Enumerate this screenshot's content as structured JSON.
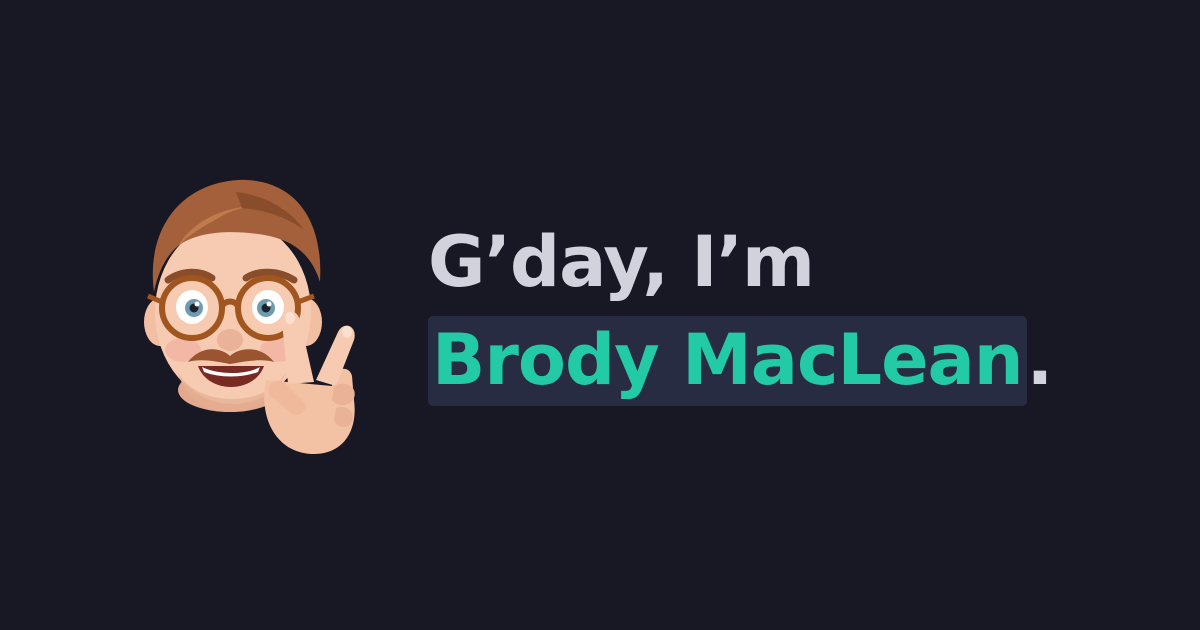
{
  "greeting": "G’day, I’m",
  "name": "Brody MacLean",
  "name_suffix": ".",
  "colors": {
    "background": "#181824",
    "greeting_text": "#d2d2dc",
    "name_text": "#22cba6",
    "name_highlight_bg": "#282c42"
  },
  "avatar": {
    "icon": "memoji-peace-sign-icon"
  }
}
